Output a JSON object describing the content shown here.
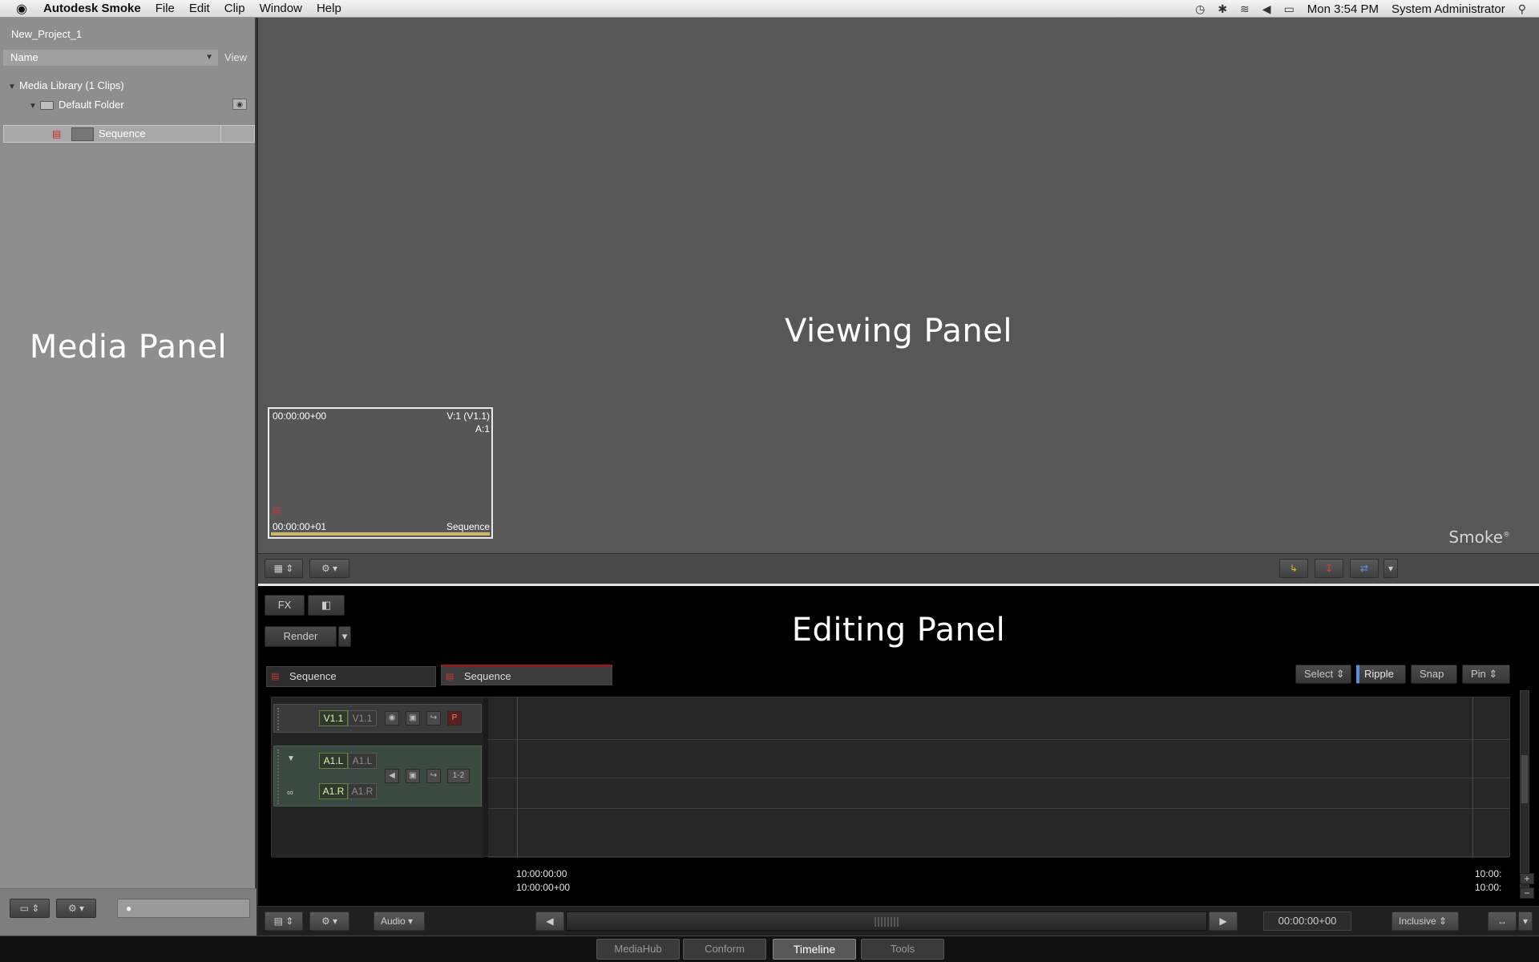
{
  "menubar": {
    "app_name": "Autodesk Smoke",
    "items": [
      "File",
      "Edit",
      "Clip",
      "Window",
      "Help"
    ],
    "clock": "Mon 3:54 PM",
    "user": "System Administrator"
  },
  "media_panel": {
    "project_name": "New_Project_1",
    "column_name": "Name",
    "view_label": "View",
    "library_label": "Media Library (1 Clips)",
    "folder_label": "Default Folder",
    "sequence_label": "Sequence",
    "panel_title": "Media Panel"
  },
  "viewing_panel": {
    "panel_title": "Viewing Panel",
    "thumb": {
      "tc_in": "00:00:00+00",
      "tracks_video": "V:1 (V1.1)",
      "tracks_audio": "A:1",
      "tc_out": "00:00:00+01",
      "name": "Sequence"
    },
    "logo_text": "Smoke",
    "logo_mark": "®"
  },
  "editing_panel": {
    "panel_title": "Editing Panel",
    "fx_label": "FX",
    "render_label": "Render",
    "tabs": [
      "Sequence",
      "Sequence"
    ],
    "modes": {
      "select": "Select",
      "ripple": "Ripple",
      "snap": "Snap",
      "pin": "Pin"
    },
    "tracks": {
      "v_src": "V1.1",
      "v_dst": "V1.1",
      "p_label": "P",
      "al_src": "A1.L",
      "al_dst": "A1.L",
      "ar_src": "A1.R",
      "ar_dst": "A1.R",
      "channel": "1-2"
    },
    "timecodes": {
      "start_top": "10:00:00:00",
      "start_bottom": "10:00:00+00",
      "end_top": "10:00:",
      "end_bottom": "10:00:"
    }
  },
  "edit_toolbar": {
    "audio_label": "Audio",
    "timecode": "00:00:00+00",
    "inclusive_label": "Inclusive"
  },
  "app_tabs": [
    {
      "label": "MediaHub",
      "active": false
    },
    {
      "label": "Conform",
      "active": false
    },
    {
      "label": "Timeline",
      "active": true
    },
    {
      "label": "Tools",
      "active": false
    }
  ]
}
